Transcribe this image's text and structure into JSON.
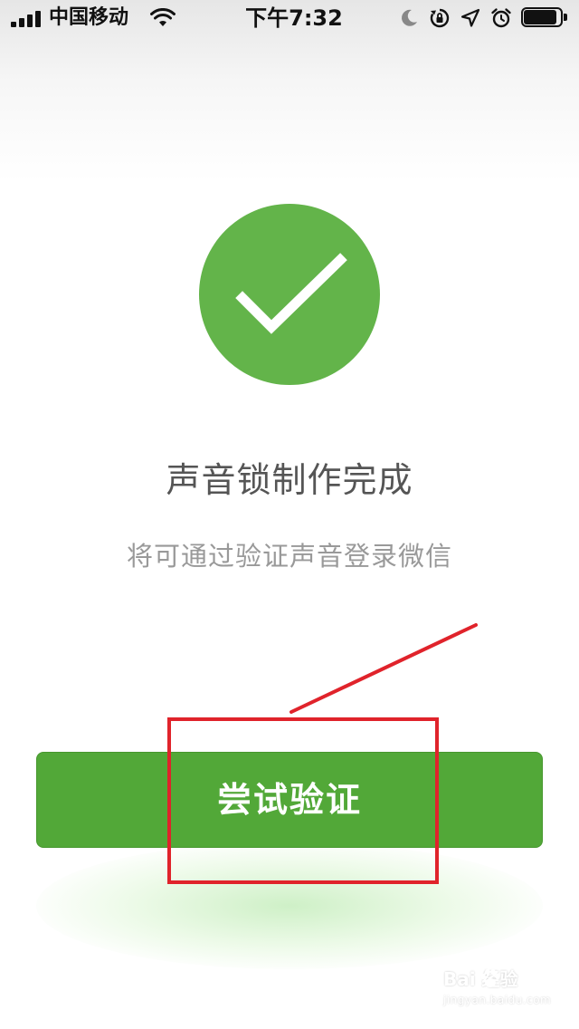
{
  "status_bar": {
    "carrier": "中国移动",
    "time": "下午7:32",
    "battery_level": 0.9,
    "icons": [
      "signal-icon",
      "wifi-icon",
      "moon-icon",
      "rotation-lock-icon",
      "location-icon",
      "alarm-icon",
      "battery-icon"
    ]
  },
  "content": {
    "status_icon": "checkmark-icon",
    "title": "声音锁制作完成",
    "subtitle": "将可通过验证声音登录微信"
  },
  "primary_button": {
    "label": "尝试验证"
  },
  "colors": {
    "accent_green": "#63b44a",
    "button_green": "#52a838",
    "annotation_red": "#e0232b"
  },
  "watermark": {
    "logo": "Bai  经验",
    "url": "jingyan.baidu.com"
  }
}
